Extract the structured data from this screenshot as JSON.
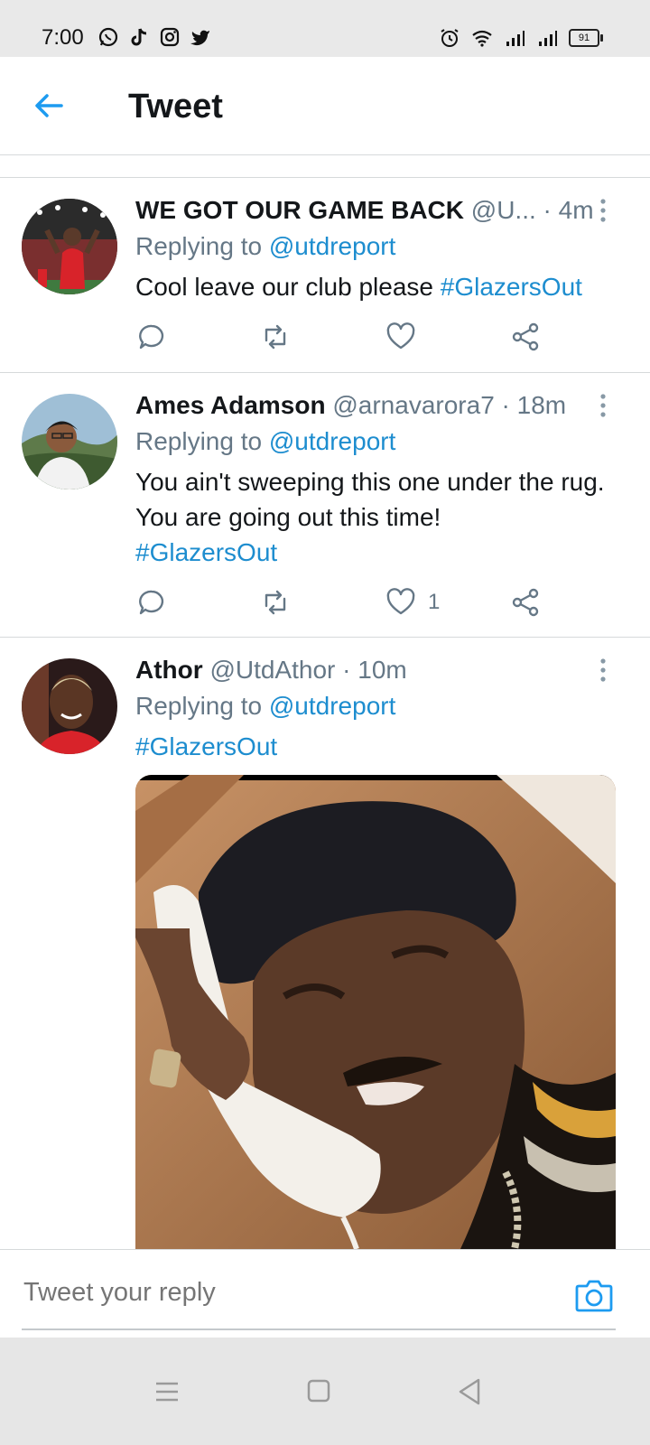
{
  "status_bar": {
    "time": "7:00",
    "left_icons": [
      "whatsapp-icon",
      "tiktok-icon",
      "instagram-icon",
      "twitter-icon"
    ],
    "right_icons": [
      "alarm-icon",
      "wifi-icon",
      "signal-icon",
      "signal-icon"
    ],
    "battery": "91"
  },
  "header": {
    "title": "Tweet",
    "back_icon": "arrow-left-icon"
  },
  "tweets": [
    {
      "name": "WE GOT OUR GAME BACK",
      "meta": "@U... · 4m",
      "replying_prefix": "Replying to ",
      "replying_handle": "@utdreport",
      "text": "Cool leave our club please ",
      "hashtag": "#GlazersOut",
      "like_count": ""
    },
    {
      "name": "Ames Adamson",
      "meta": "@arnavarora7 · 18m",
      "replying_prefix": "Replying to ",
      "replying_handle": "@utdreport",
      "text": "You ain't sweeping this one under the rug. You are going out this time!",
      "hashtag": "#GlazersOut",
      "like_count": "1"
    },
    {
      "name": "Athor",
      "meta": "@UtdAthor · 10m",
      "replying_prefix": "Replying to ",
      "replying_handle": "@utdreport",
      "text": "",
      "hashtag": "#GlazersOut",
      "like_count": ""
    }
  ],
  "reply_bar": {
    "placeholder": "Tweet your reply",
    "camera_icon": "camera-icon"
  },
  "nav_bar": {
    "icons": [
      "menu-icon",
      "home-square-icon",
      "back-triangle-icon"
    ]
  },
  "colors": {
    "accent": "#1d8dcf",
    "muted": "#657786",
    "text": "#14171a",
    "divider": "#d6d9db"
  }
}
